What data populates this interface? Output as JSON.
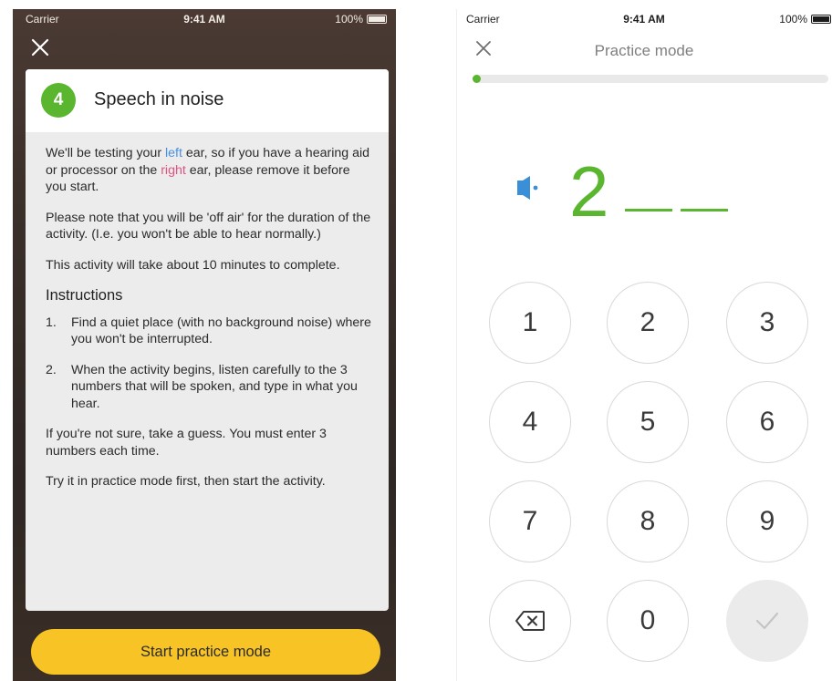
{
  "left": {
    "status": {
      "carrier": "Carrier",
      "time": "9:41 AM",
      "battery": "100%"
    },
    "card": {
      "step_number": "4",
      "title": "Speech in noise",
      "intro": {
        "pre": "We'll be testing your ",
        "ear": "left",
        "mid": " ear, so if you have a hearing aid or processor on the ",
        "other_ear": "right",
        "post": " ear, please remove it before you start."
      },
      "note": "Please note that you will be 'off air' for the duration of the activity. (I.e. you won't be able to hear normally.)",
      "duration": "This activity will take about 10 minutes to complete.",
      "instructions_heading": "Instructions",
      "instructions": [
        {
          "num": "1.",
          "text": "Find a quiet place (with no background noise) where you won't be interrupted."
        },
        {
          "num": "2.",
          "text": "When the activity begins, listen carefully to the 3 numbers that will be spoken, and type in what you hear."
        }
      ],
      "guess_note": "If you're not sure, take a guess. You must enter 3 numbers each time.",
      "practice_note": "Try it in practice mode first, then start the activity."
    },
    "button_label": "Start practice mode",
    "colors": {
      "badge": "#5ab52f",
      "button": "#f7c325",
      "left_ear": "#4a90e2",
      "right_ear": "#e2537f"
    }
  },
  "right": {
    "status": {
      "carrier": "Carrier",
      "time": "9:41 AM",
      "battery": "100%"
    },
    "title": "Practice mode",
    "progress": 0.02,
    "entered_digit": "2",
    "keypad": [
      "1",
      "2",
      "3",
      "4",
      "5",
      "6",
      "7",
      "8",
      "9",
      "0"
    ],
    "icons": {
      "close": "close-icon",
      "speaker": "speaker-icon",
      "backspace": "backspace-icon",
      "confirm": "check-icon"
    },
    "colors": {
      "accent": "#5ab52f"
    }
  }
}
